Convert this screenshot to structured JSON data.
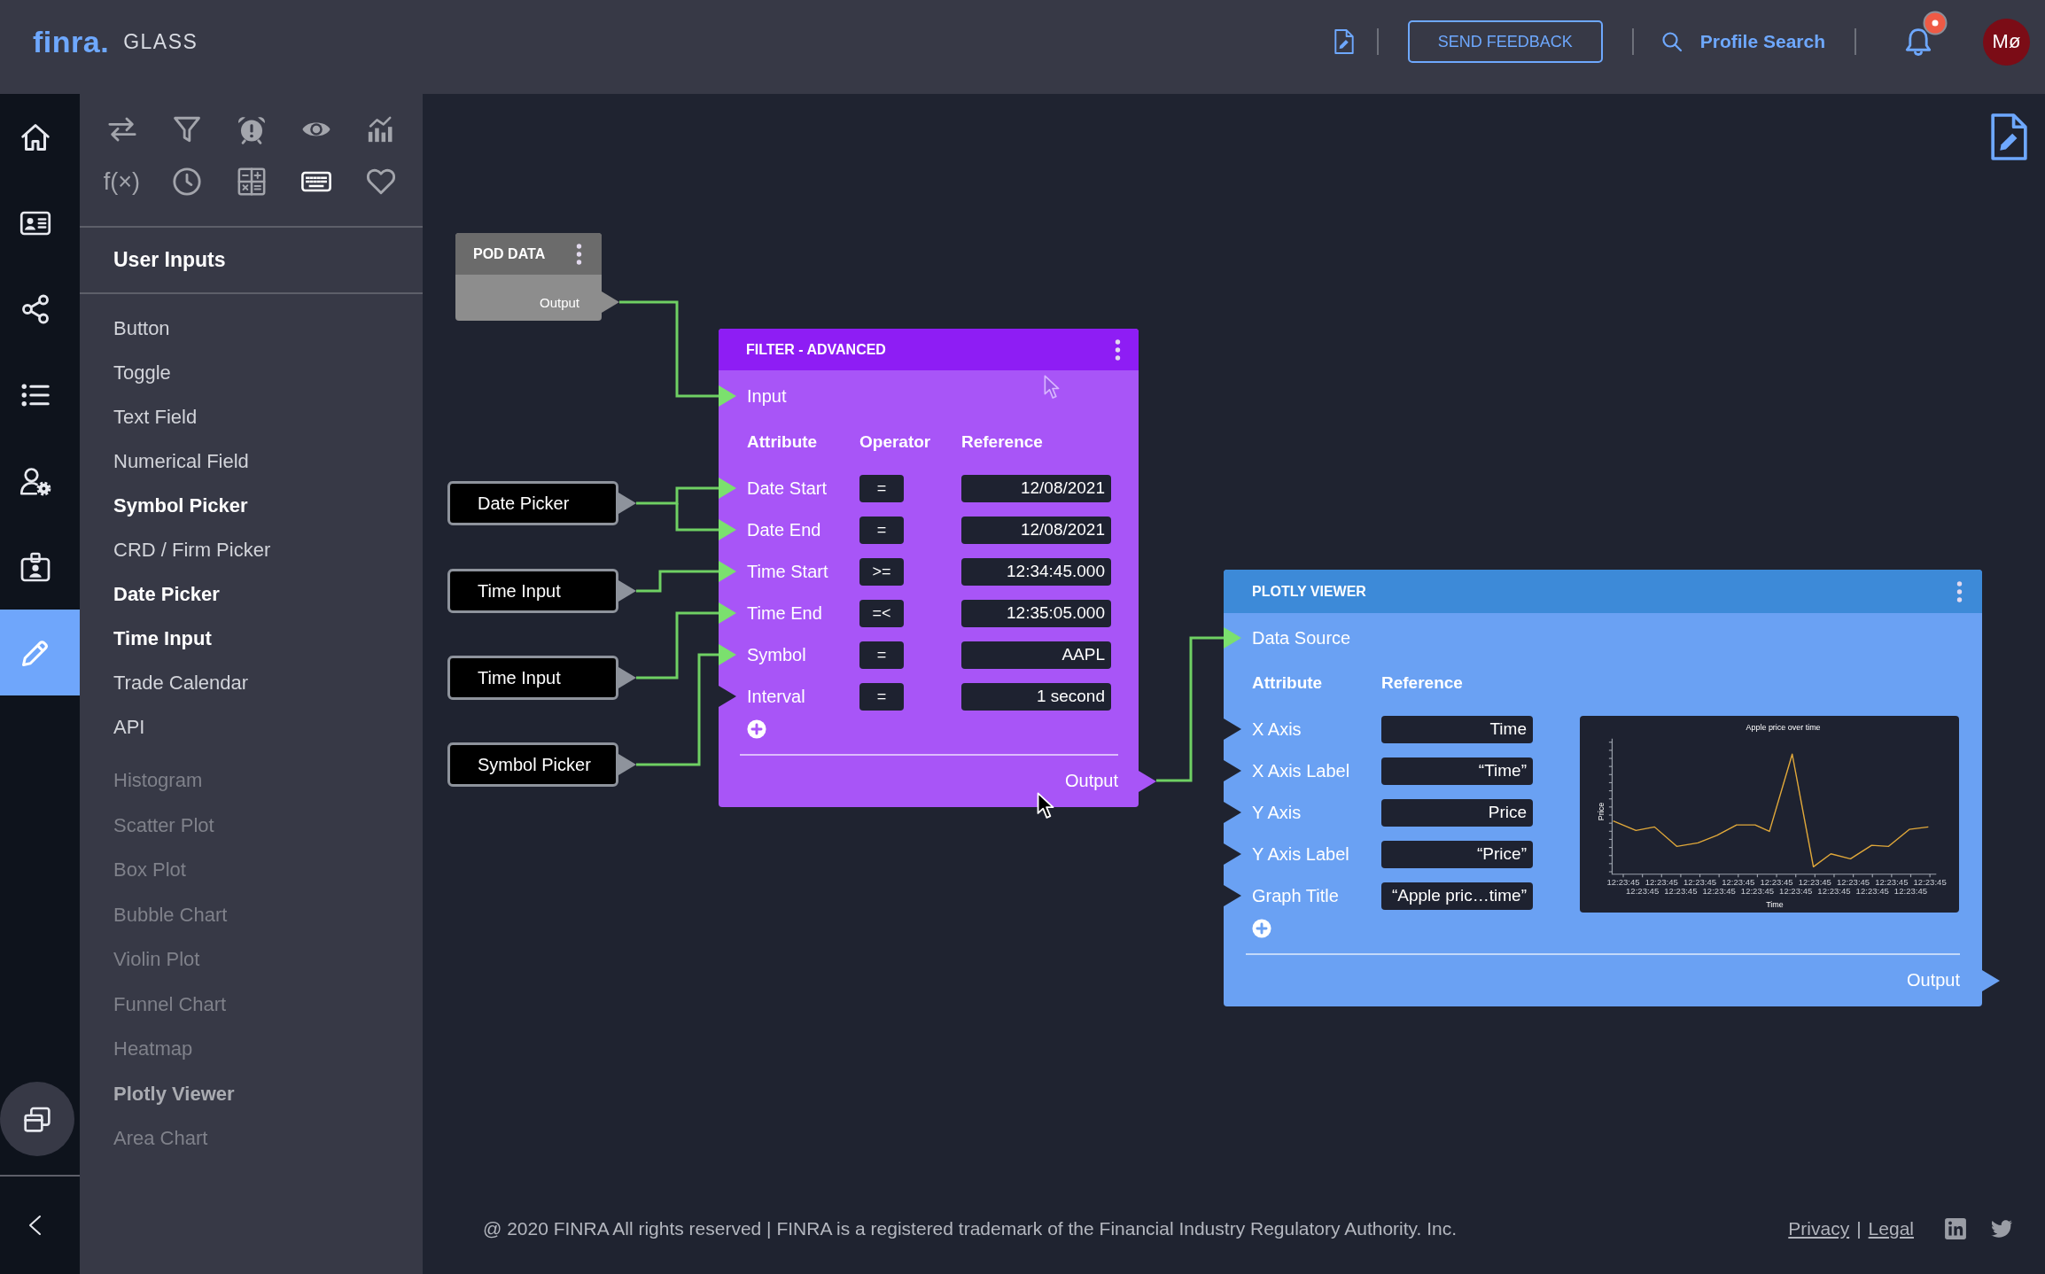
{
  "header": {
    "logo": "finra.",
    "product": "GLASS",
    "feedback_button": "SEND FEEDBACK",
    "profile_search": "Profile Search",
    "notifications": {
      "unread": true
    },
    "avatar": "Mø"
  },
  "nav_rail": [
    {
      "kind": "home",
      "selected": false
    },
    {
      "kind": "contact-card",
      "selected": false
    },
    {
      "kind": "share",
      "selected": false
    },
    {
      "kind": "list",
      "selected": false
    },
    {
      "kind": "user-settings",
      "selected": false
    },
    {
      "kind": "id-badge",
      "selected": false
    },
    {
      "kind": "pencil",
      "selected": true
    }
  ],
  "component_panel": {
    "categories": [
      {
        "kind": "swap",
        "selected": false
      },
      {
        "kind": "funnel",
        "selected": false
      },
      {
        "kind": "alarm",
        "selected": false
      },
      {
        "kind": "eye",
        "selected": false
      },
      {
        "kind": "chart",
        "selected": false
      },
      {
        "kind": "function",
        "glyph": "f(×)",
        "selected": false
      },
      {
        "kind": "clock",
        "selected": false
      },
      {
        "kind": "calculator",
        "selected": false
      },
      {
        "kind": "keyboard",
        "selected": true
      },
      {
        "kind": "heart",
        "selected": false
      }
    ],
    "category_title": "User Inputs",
    "items": [
      {
        "label": "Button",
        "in_use": false
      },
      {
        "label": "Toggle",
        "in_use": false
      },
      {
        "label": "Text Field",
        "in_use": false
      },
      {
        "label": "Numerical Field",
        "in_use": false
      },
      {
        "label": "Symbol Picker",
        "in_use": true
      },
      {
        "label": "CRD / Firm Picker",
        "in_use": false
      },
      {
        "label": "Date Picker",
        "in_use": true
      },
      {
        "label": "Time Input",
        "in_use": true
      },
      {
        "label": "Trade Calendar",
        "in_use": false
      },
      {
        "label": "API",
        "in_use": false
      }
    ],
    "fading_items": [
      {
        "label": "Histogram",
        "in_use": false
      },
      {
        "label": "Scatter Plot",
        "in_use": false
      },
      {
        "label": "Box Plot",
        "in_use": false
      },
      {
        "label": "Bubble Chart",
        "in_use": false
      },
      {
        "label": "Violin Plot",
        "in_use": false
      },
      {
        "label": "Funnel Chart",
        "in_use": false
      },
      {
        "label": "Heatmap",
        "in_use": false
      },
      {
        "label": "Plotly Viewer",
        "in_use": true
      },
      {
        "label": "Area Chart",
        "in_use": false
      }
    ]
  },
  "canvas": {
    "nodes": [
      {
        "kind": "source",
        "title": "POD DATA",
        "output": "Output"
      },
      {
        "kind": "input",
        "title": "Date Picker"
      },
      {
        "kind": "input",
        "title": "Time Input"
      },
      {
        "kind": "input",
        "title": "Time Input"
      },
      {
        "kind": "input",
        "title": "Symbol Picker"
      },
      {
        "kind": "filter",
        "title": "FILTER - ADVANCED",
        "input": {
          "label": "Input",
          "connected": true
        },
        "columns": [
          "Attribute",
          "Operator",
          "Reference"
        ],
        "rows": [
          {
            "attribute": "Date Start",
            "operator": "=",
            "reference": "12/08/2021",
            "connected": true
          },
          {
            "attribute": "Date End",
            "operator": "=",
            "reference": "12/08/2021",
            "connected": true
          },
          {
            "attribute": "Time Start",
            "operator": ">=",
            "reference": "12:34:45.000",
            "connected": true
          },
          {
            "attribute": "Time End",
            "operator": "=<",
            "reference": "12:35:05.000",
            "connected": true
          },
          {
            "attribute": "Symbol",
            "operator": "=",
            "reference": "AAPL",
            "connected": true
          },
          {
            "attribute": "Interval",
            "operator": "=",
            "reference": "1 second",
            "connected": false
          }
        ],
        "output": "Output"
      },
      {
        "kind": "viewer",
        "title": "PLOTLY VIEWER",
        "input": {
          "label": "Data Source",
          "connected": true
        },
        "columns": [
          "Attribute",
          "Reference"
        ],
        "rows": [
          {
            "attribute": "X Axis",
            "reference": "Time",
            "connected": false
          },
          {
            "attribute": "X Axis Label",
            "reference": "“Time”",
            "connected": false
          },
          {
            "attribute": "Y Axis",
            "reference": "Price",
            "connected": false
          },
          {
            "attribute": "Y Axis Label",
            "reference": "“Price”",
            "connected": false
          },
          {
            "attribute": "Graph Title",
            "reference": "“Apple pric…time”",
            "connected": false
          }
        ],
        "chart": {
          "title": "Apple price over time",
          "xlabel": "Time",
          "ylabel": "Price",
          "x_tick_labels": [
            "12:23:45",
            "12:23:45",
            "12:23:45",
            "12:23:45",
            "12:23:45",
            "12:23:45",
            "12:23:45",
            "12:23:45",
            "12:23:45",
            "12:23:45",
            "12:23:45",
            "12:23:45",
            "12:23:45",
            "12:23:45",
            "12:23:45",
            "12:23:45",
            "12:23:45"
          ]
        },
        "output": "Output"
      }
    ]
  },
  "footer": {
    "copyright": "@ 2020 FINRA All rights reserved | FINRA is a registered trademark of the Financial Industry Regulatory Authority. Inc.",
    "links": [
      "Privacy",
      "Legal"
    ],
    "link_separator": "|"
  }
}
